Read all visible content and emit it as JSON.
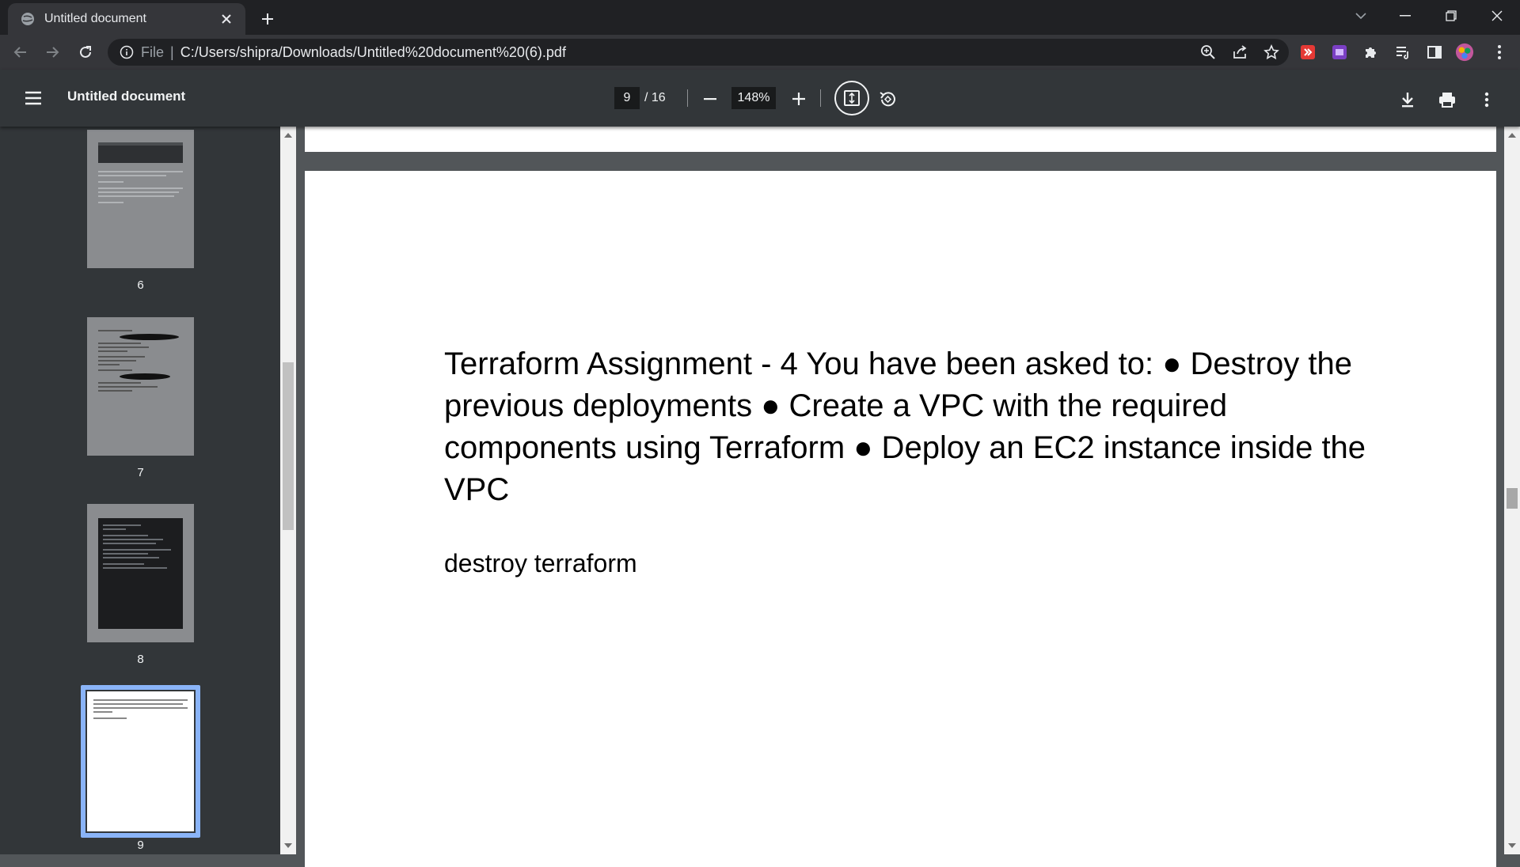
{
  "browser": {
    "tab": {
      "title": "Untitled document"
    },
    "omnibox": {
      "scheme": "File",
      "url": "C:/Users/shipra/Downloads/Untitled%20document%20(6).pdf"
    }
  },
  "pdf_toolbar": {
    "title": "Untitled document",
    "current_page": "9",
    "page_total": "/ 16",
    "zoom": "148%"
  },
  "thumbnails": [
    {
      "label": "6",
      "style": "dark-header"
    },
    {
      "label": "7",
      "style": "code-redacted"
    },
    {
      "label": "8",
      "style": "terminal"
    },
    {
      "label": "9",
      "style": "text",
      "selected": true
    }
  ],
  "page": {
    "heading": "Terraform Assignment - 4 You have been asked to: ● Destroy the previous deployments ● Create a VPC with the required components using Terraform ● Deploy an EC2 instance inside the VPC",
    "line2": "destroy terraform"
  },
  "colors": {
    "accent_selection": "#8ab4f8",
    "toolbar_bg": "#323639",
    "viewer_bg": "#525659"
  }
}
